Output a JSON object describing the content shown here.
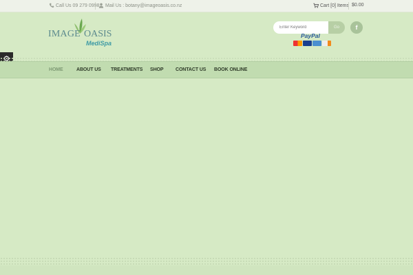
{
  "topbar": {
    "phone": "Call Us 09 279 0998",
    "mail": "Mail Us : botany@imageoasis.co.nz",
    "cart": "Cart [0] Items",
    "cart_total": "$0.00"
  },
  "logo": {
    "word1": "IMAGE",
    "word2": "OASIS",
    "tagline": "MediSpa"
  },
  "search": {
    "placeholder": "Enter Keyword",
    "button_label": "Go"
  },
  "social": {
    "facebook": "f"
  },
  "payment": {
    "paypal": "PayPal"
  },
  "nav": {
    "items": [
      {
        "label": "HOME"
      },
      {
        "label": "ABOUT US"
      },
      {
        "label": "TREATMENTS"
      },
      {
        "label": "SHOP"
      },
      {
        "label": "CONTACT US"
      },
      {
        "label": "BOOK ONLINE"
      }
    ],
    "active": "HOME"
  },
  "colors": {
    "background": "#d6eac5",
    "nav_bar": "#c1dcb0",
    "logo_teal": "#5c8a8e",
    "nav_active": "#7e9a74"
  },
  "icons": {
    "phone": "phone-icon",
    "mail": "user-icon",
    "cart": "cart-icon",
    "settings": "gear-icon"
  }
}
